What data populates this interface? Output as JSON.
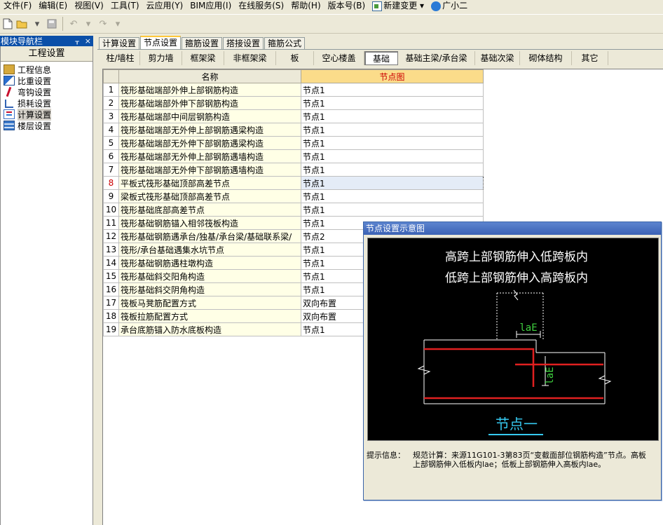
{
  "menu": [
    {
      "label": "文件(F)"
    },
    {
      "label": "编辑(E)"
    },
    {
      "label": "视图(V)"
    },
    {
      "label": "工具(T)"
    },
    {
      "label": "云应用(Y)"
    },
    {
      "label": "BIM应用(I)"
    },
    {
      "label": "在线服务(S)"
    },
    {
      "label": "帮助(H)"
    },
    {
      "label": "版本号(B)"
    },
    {
      "label": "新建变更 ▾",
      "icon": "document-icon"
    },
    {
      "label": "广小二",
      "icon": "assistant-icon"
    }
  ],
  "nav": {
    "title": "模块导航栏",
    "pin": "ᚁ",
    "close": "×",
    "section": "工程设置",
    "items": [
      "工程信息",
      "比重设置",
      "弯钩设置",
      "损耗设置",
      "计算设置",
      "楼层设置"
    ],
    "active_index": 4
  },
  "main_tabs": [
    "计算设置",
    "节点设置",
    "箍筋设置",
    "搭接设置",
    "箍筋公式"
  ],
  "main_tab_active": 1,
  "sub_tabs": [
    "柱/墙柱",
    "剪力墙",
    "框架梁",
    "非框架梁",
    "板",
    "空心楼盖",
    "基础",
    "基础主梁/承台梁",
    "基础次梁",
    "砌体结构",
    "其它"
  ],
  "sub_tab_active": 6,
  "grid": {
    "col_name": "名称",
    "col_value": "节点图",
    "rows": [
      {
        "n": "1",
        "name": "筏形基础端部外伸上部钢筋构造",
        "value": "节点1"
      },
      {
        "n": "2",
        "name": "筏形基础端部外伸下部钢筋构造",
        "value": "节点1"
      },
      {
        "n": "3",
        "name": "筏形基础端部中间层钢筋构造",
        "value": "节点1"
      },
      {
        "n": "4",
        "name": "筏形基础端部无外伸上部钢筋遇梁构造",
        "value": "节点1"
      },
      {
        "n": "5",
        "name": "筏形基础端部无外伸下部钢筋遇梁构造",
        "value": "节点1"
      },
      {
        "n": "6",
        "name": "筏形基础端部无外伸上部钢筋遇墙构造",
        "value": "节点1"
      },
      {
        "n": "7",
        "name": "筏形基础端部无外伸下部钢筋遇墙构造",
        "value": "节点1"
      },
      {
        "n": "8",
        "name": "平板式筏形基础顶部高差节点",
        "value": "节点1"
      },
      {
        "n": "9",
        "name": "梁板式筏形基础顶部高差节点",
        "value": "节点1"
      },
      {
        "n": "10",
        "name": "筏形基础底部高差节点",
        "value": "节点1"
      },
      {
        "n": "11",
        "name": "筏形基础钢筋锚入相邻筏板构造",
        "value": "节点1"
      },
      {
        "n": "12",
        "name": "筏形基础钢筋遇承台/独基/承台梁/基础联系梁/",
        "value": "节点2"
      },
      {
        "n": "13",
        "name": "筏形/承台基础遇集水坑节点",
        "value": "节点1"
      },
      {
        "n": "14",
        "name": "筏形基础钢筋遇柱墩构造",
        "value": "节点1"
      },
      {
        "n": "15",
        "name": "筏形基础斜交阳角构造",
        "value": "节点1"
      },
      {
        "n": "16",
        "name": "筏形基础斜交阴角构造",
        "value": "节点1"
      },
      {
        "n": "17",
        "name": "筏板马凳筋配置方式",
        "value": "双向布置"
      },
      {
        "n": "18",
        "name": "筏板拉筋配置方式",
        "value": "双向布置"
      },
      {
        "n": "19",
        "name": "承台底筋锚入防水底板构造",
        "value": "节点1"
      }
    ],
    "selected_row": 7
  },
  "diagram": {
    "title": "节点设置示意图",
    "line1": "高跨上部钢筋伸入低跨板内",
    "line2": "低跨上部钢筋伸入高跨板内",
    "dim_h": "laE",
    "dim_v": "laE",
    "node_label": "节点一",
    "info_label": "提示信息：",
    "info_text": "规范计算：来源11G101-3第83页“变截面部位钢筋构造”节点。高板上部钢筋伸入低板内lae；低板上部钢筋伸入高板内lae。"
  }
}
